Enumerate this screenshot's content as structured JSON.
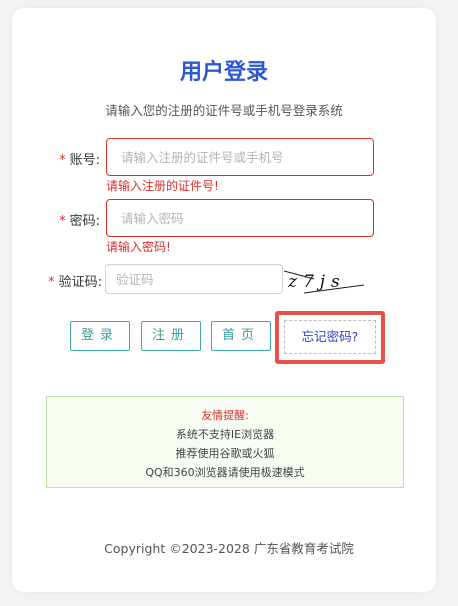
{
  "login": {
    "title": "用户登录",
    "subtitle": "请输入您的注册的证件号或手机号登录系统",
    "required_mark": "*",
    "account": {
      "label": "账号:",
      "placeholder": "请输入注册的证件号或手机号",
      "value": "",
      "error": "请输入注册的证件号!"
    },
    "password": {
      "label": "密码:",
      "placeholder": "请输入密码",
      "value": "",
      "error": "请输入密码!"
    },
    "captcha": {
      "label": "验证码:",
      "placeholder": "验证码",
      "value": "",
      "image_text": "z7js"
    },
    "buttons": {
      "login": "登录",
      "register": "注册",
      "home": "首页",
      "forgot": "忘记密码?"
    },
    "tips": {
      "title": "友情提醒:",
      "lines": [
        "系统不支持IE浏览器",
        "推荐使用谷歌或火狐",
        "QQ和360浏览器请使用极速模式"
      ]
    },
    "footer": "Copyright ©2023-2028 广东省教育考试院"
  },
  "colors": {
    "title": "#2d58d2",
    "error": "#d9302c",
    "button_border": "#3faaaa",
    "highlight": "#e5524a",
    "tips_border": "#b7e2a8",
    "tips_bg": "#f6fcf2"
  }
}
